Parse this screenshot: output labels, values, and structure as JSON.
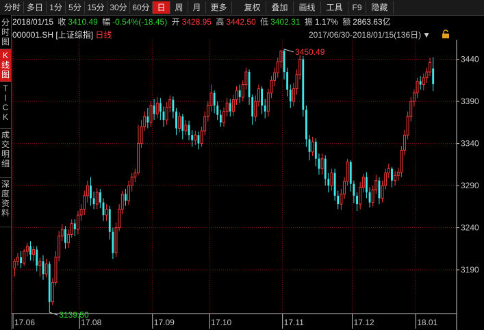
{
  "toolbar": {
    "buttons": [
      "分时",
      "多日",
      "1分",
      "5分",
      "15分",
      "30分",
      "60分",
      "日",
      "周",
      "月",
      "更多",
      "复权",
      "叠加",
      "画线",
      "工具",
      "F9",
      "隐藏"
    ],
    "active": "日"
  },
  "sidetabs": [
    {
      "label": "分时图",
      "active": false
    },
    {
      "label": "K线图",
      "active": true
    },
    {
      "label": "TICK",
      "active": false
    },
    {
      "label": "成交明细",
      "active": false
    },
    {
      "label": "深度资料",
      "active": false
    }
  ],
  "infobar": {
    "date": "2018/01/15",
    "close_label": "收",
    "close": "3410.49",
    "change_label": "幅",
    "change": "-0.54%(-18.45)",
    "open_label": "开",
    "open": "3428.95",
    "high_label": "高",
    "high": "3442.50",
    "low_label": "低",
    "low": "3402.31",
    "amp_label": "振",
    "amp": "1.17%",
    "vol_label": "额",
    "vol": "2863.63亿"
  },
  "title": {
    "code": "000001.SH",
    "name": "[上证综指]",
    "period": "日线",
    "range": "2017/06/30-2018/01/15(136日)"
  },
  "colors": {
    "up": "#ff3a3a",
    "down": "#3fe8e8",
    "grid": "#8a1010",
    "axis": "#c8c8c8",
    "bg": "#000000"
  },
  "chart_data": {
    "type": "candlestick",
    "y_ticks": [
      3190,
      3240,
      3290,
      3340,
      3390,
      3440
    ],
    "x_ticks": [
      "17.06",
      "17.08",
      "17.09",
      "17.10",
      "17.11",
      "17.12",
      "18.01"
    ],
    "annotations": {
      "high": "3450.49",
      "low": "3139.50"
    },
    "high_value": 3450.49,
    "low_value": 3139.5,
    "ylim": [
      3138,
      3460
    ],
    "candles": [
      [
        3192,
        3200,
        3182,
        3203
      ],
      [
        3200,
        3205,
        3195,
        3210
      ],
      [
        3205,
        3198,
        3192,
        3212
      ],
      [
        3198,
        3212,
        3195,
        3215
      ],
      [
        3212,
        3218,
        3206,
        3222
      ],
      [
        3218,
        3208,
        3201,
        3224
      ],
      [
        3208,
        3214,
        3200,
        3218
      ],
      [
        3214,
        3195,
        3188,
        3218
      ],
      [
        3195,
        3200,
        3182,
        3204
      ],
      [
        3200,
        3185,
        3178,
        3207
      ],
      [
        3185,
        3197,
        3181,
        3203
      ],
      [
        3197,
        3152,
        3139.5,
        3200
      ],
      [
        3152,
        3175,
        3148,
        3180
      ],
      [
        3175,
        3205,
        3171,
        3212
      ],
      [
        3205,
        3230,
        3200,
        3236
      ],
      [
        3230,
        3238,
        3224,
        3244
      ],
      [
        3238,
        3222,
        3215,
        3242
      ],
      [
        3222,
        3232,
        3216,
        3238
      ],
      [
        3232,
        3245,
        3228,
        3250
      ],
      [
        3245,
        3238,
        3230,
        3250
      ],
      [
        3238,
        3255,
        3232,
        3260
      ],
      [
        3255,
        3262,
        3248,
        3268
      ],
      [
        3262,
        3278,
        3255,
        3284
      ],
      [
        3278,
        3290,
        3270,
        3296
      ],
      [
        3290,
        3275,
        3266,
        3300
      ],
      [
        3275,
        3268,
        3262,
        3283
      ],
      [
        3268,
        3282,
        3262,
        3287
      ],
      [
        3282,
        3270,
        3263,
        3286
      ],
      [
        3270,
        3255,
        3248,
        3275
      ],
      [
        3255,
        3262,
        3248,
        3268
      ],
      [
        3262,
        3235,
        3226,
        3266
      ],
      [
        3235,
        3210,
        3203,
        3240
      ],
      [
        3210,
        3240,
        3205,
        3246
      ],
      [
        3240,
        3262,
        3236,
        3268
      ],
      [
        3262,
        3280,
        3256,
        3284
      ],
      [
        3280,
        3272,
        3266,
        3286
      ],
      [
        3272,
        3290,
        3267,
        3296
      ],
      [
        3290,
        3300,
        3283,
        3305
      ],
      [
        3300,
        3305,
        3294,
        3310
      ],
      [
        3305,
        3340,
        3302,
        3362
      ],
      [
        3340,
        3360,
        3335,
        3368
      ],
      [
        3360,
        3372,
        3355,
        3378
      ],
      [
        3372,
        3365,
        3358,
        3382
      ],
      [
        3365,
        3385,
        3360,
        3390
      ],
      [
        3385,
        3375,
        3368,
        3393
      ],
      [
        3375,
        3388,
        3370,
        3395
      ],
      [
        3388,
        3378,
        3368,
        3394
      ],
      [
        3378,
        3368,
        3360,
        3384
      ],
      [
        3368,
        3383,
        3362,
        3389
      ],
      [
        3383,
        3392,
        3377,
        3397
      ],
      [
        3392,
        3378,
        3370,
        3396
      ],
      [
        3378,
        3358,
        3350,
        3382
      ],
      [
        3358,
        3372,
        3353,
        3377
      ],
      [
        3372,
        3355,
        3345,
        3375
      ],
      [
        3355,
        3362,
        3350,
        3368
      ],
      [
        3362,
        3350,
        3344,
        3367
      ],
      [
        3350,
        3344,
        3336,
        3356
      ],
      [
        3344,
        3350,
        3338,
        3355
      ],
      [
        3350,
        3340,
        3333,
        3354
      ],
      [
        3340,
        3355,
        3336,
        3360
      ],
      [
        3355,
        3372,
        3350,
        3378
      ],
      [
        3372,
        3385,
        3366,
        3390
      ],
      [
        3385,
        3400,
        3378,
        3410
      ],
      [
        3400,
        3385,
        3376,
        3403
      ],
      [
        3385,
        3374,
        3368,
        3390
      ],
      [
        3374,
        3365,
        3360,
        3380
      ],
      [
        3365,
        3378,
        3360,
        3383
      ],
      [
        3378,
        3388,
        3372,
        3394
      ],
      [
        3388,
        3378,
        3372,
        3393
      ],
      [
        3378,
        3392,
        3373,
        3398
      ],
      [
        3392,
        3403,
        3386,
        3408
      ],
      [
        3403,
        3395,
        3388,
        3410
      ],
      [
        3395,
        3410,
        3390,
        3415
      ],
      [
        3410,
        3425,
        3404,
        3430
      ],
      [
        3425,
        3395,
        3386,
        3428
      ],
      [
        3395,
        3372,
        3362,
        3398
      ],
      [
        3372,
        3390,
        3366,
        3397
      ],
      [
        3390,
        3405,
        3384,
        3410
      ],
      [
        3405,
        3385,
        3375,
        3408
      ],
      [
        3385,
        3378,
        3370,
        3393
      ],
      [
        3378,
        3400,
        3372,
        3405
      ],
      [
        3400,
        3415,
        3394,
        3420
      ],
      [
        3415,
        3424,
        3408,
        3430
      ],
      [
        3424,
        3437,
        3418,
        3442
      ],
      [
        3437,
        3450,
        3430,
        3450.49
      ],
      [
        3450,
        3425,
        3416,
        3452
      ],
      [
        3425,
        3404,
        3396,
        3430
      ],
      [
        3404,
        3390,
        3382,
        3410
      ],
      [
        3390,
        3405,
        3384,
        3412
      ],
      [
        3405,
        3422,
        3398,
        3428
      ],
      [
        3422,
        3440,
        3416,
        3445
      ],
      [
        3440,
        3380,
        3372,
        3444
      ],
      [
        3380,
        3345,
        3336,
        3385
      ],
      [
        3345,
        3330,
        3320,
        3350
      ],
      [
        3330,
        3342,
        3325,
        3348
      ],
      [
        3342,
        3322,
        3313,
        3346
      ],
      [
        3322,
        3310,
        3303,
        3328
      ],
      [
        3310,
        3322,
        3303,
        3328
      ],
      [
        3322,
        3298,
        3290,
        3326
      ],
      [
        3298,
        3290,
        3282,
        3305
      ],
      [
        3290,
        3305,
        3284,
        3310
      ],
      [
        3305,
        3278,
        3272,
        3310
      ],
      [
        3278,
        3268,
        3262,
        3284
      ],
      [
        3268,
        3280,
        3261,
        3286
      ],
      [
        3280,
        3295,
        3274,
        3300
      ],
      [
        3295,
        3318,
        3290,
        3322
      ],
      [
        3318,
        3292,
        3283,
        3320
      ],
      [
        3292,
        3278,
        3269,
        3296
      ],
      [
        3278,
        3268,
        3260,
        3282
      ],
      [
        3268,
        3288,
        3262,
        3294
      ],
      [
        3288,
        3300,
        3282,
        3304
      ],
      [
        3300,
        3282,
        3275,
        3306
      ],
      [
        3282,
        3270,
        3264,
        3288
      ],
      [
        3270,
        3285,
        3265,
        3290
      ],
      [
        3285,
        3296,
        3280,
        3303
      ],
      [
        3296,
        3275,
        3268,
        3300
      ],
      [
        3275,
        3290,
        3270,
        3296
      ],
      [
        3290,
        3305,
        3285,
        3310
      ],
      [
        3305,
        3310,
        3299,
        3316
      ],
      [
        3310,
        3296,
        3288,
        3312
      ],
      [
        3296,
        3302,
        3290,
        3307
      ],
      [
        3302,
        3306,
        3296,
        3311
      ],
      [
        3306,
        3332,
        3300,
        3337
      ],
      [
        3332,
        3350,
        3326,
        3356
      ],
      [
        3350,
        3372,
        3345,
        3378
      ],
      [
        3372,
        3390,
        3366,
        3395
      ],
      [
        3390,
        3400,
        3384,
        3404
      ],
      [
        3400,
        3414,
        3394,
        3418
      ],
      [
        3414,
        3410,
        3404,
        3420
      ],
      [
        3410,
        3418,
        3403,
        3423
      ],
      [
        3418,
        3425,
        3412,
        3430
      ],
      [
        3425,
        3436,
        3420,
        3442
      ],
      [
        3428.95,
        3410.49,
        3402.31,
        3442.5
      ]
    ]
  }
}
